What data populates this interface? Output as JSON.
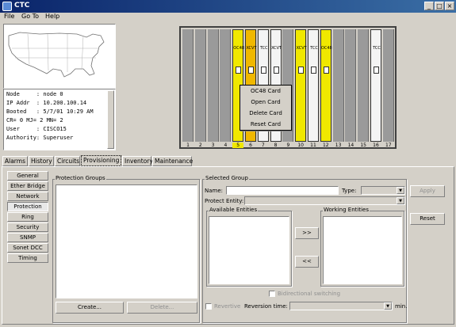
{
  "window": {
    "title": "CTC",
    "controls": [
      "_",
      "□",
      "×"
    ]
  },
  "menu": [
    "File",
    "Go To",
    "Help"
  ],
  "node_info": {
    "lines": [
      "Node     : node 0",
      "IP Addr  : 10.200.100.14",
      "Booted   : 5/7/01 10:29 AM",
      "CR= 0 MJ= 2 MN= 2",
      "User     : CISCO15",
      "Authority: Superuser"
    ]
  },
  "shelf": {
    "slot_numbers": [
      "1",
      "2",
      "3",
      "4",
      "5",
      "6",
      "7",
      "8",
      "9",
      "10",
      "11",
      "12",
      "13",
      "14",
      "15",
      "16",
      "17"
    ],
    "selected_slot": "5",
    "card_labels": {
      "5": "OC48",
      "6": "XCVT",
      "7": "TCC",
      "8": "XCVT",
      "10": "XCVT",
      "11": "TCC",
      "12": "OC48",
      "16": "TCC"
    }
  },
  "context_menu": [
    "OC48 Card",
    "Open Card",
    "Delete Card",
    "Reset Card"
  ],
  "tabs": [
    "Alarms",
    "History",
    "Circuits",
    "Provisioning",
    "Inventory",
    "Maintenance"
  ],
  "active_tab": "Provisioning",
  "sidetabs": [
    "General",
    "Ether Bridge",
    "Network",
    "Protection",
    "Ring",
    "Security",
    "SNMP",
    "Sonet DCC",
    "Timing"
  ],
  "active_sidetab": "Protection",
  "protection_groups": {
    "label": "Protection Groups",
    "create_label": "Create...",
    "delete_label": "Delete..."
  },
  "selected_group": {
    "label": "Selected Group",
    "name_label": "Name:",
    "name_value": "",
    "type_label": "Type:",
    "protect_entity_label": "Protect Entity:",
    "available_label": "Available Entities",
    "working_label": "Working Entities",
    "move_right": ">>",
    "move_left": "<<",
    "bidir_label": "Bidirectional switching",
    "revertive_label": "Revertive",
    "reversion_label": "Reversion time:",
    "min_label": "min.",
    "apply_label": "Apply",
    "reset_label": "Reset"
  },
  "colors": {
    "titlebar_start": "#0a246a",
    "card_yellow": "#f0e800",
    "card_orange": "#f0b800"
  }
}
